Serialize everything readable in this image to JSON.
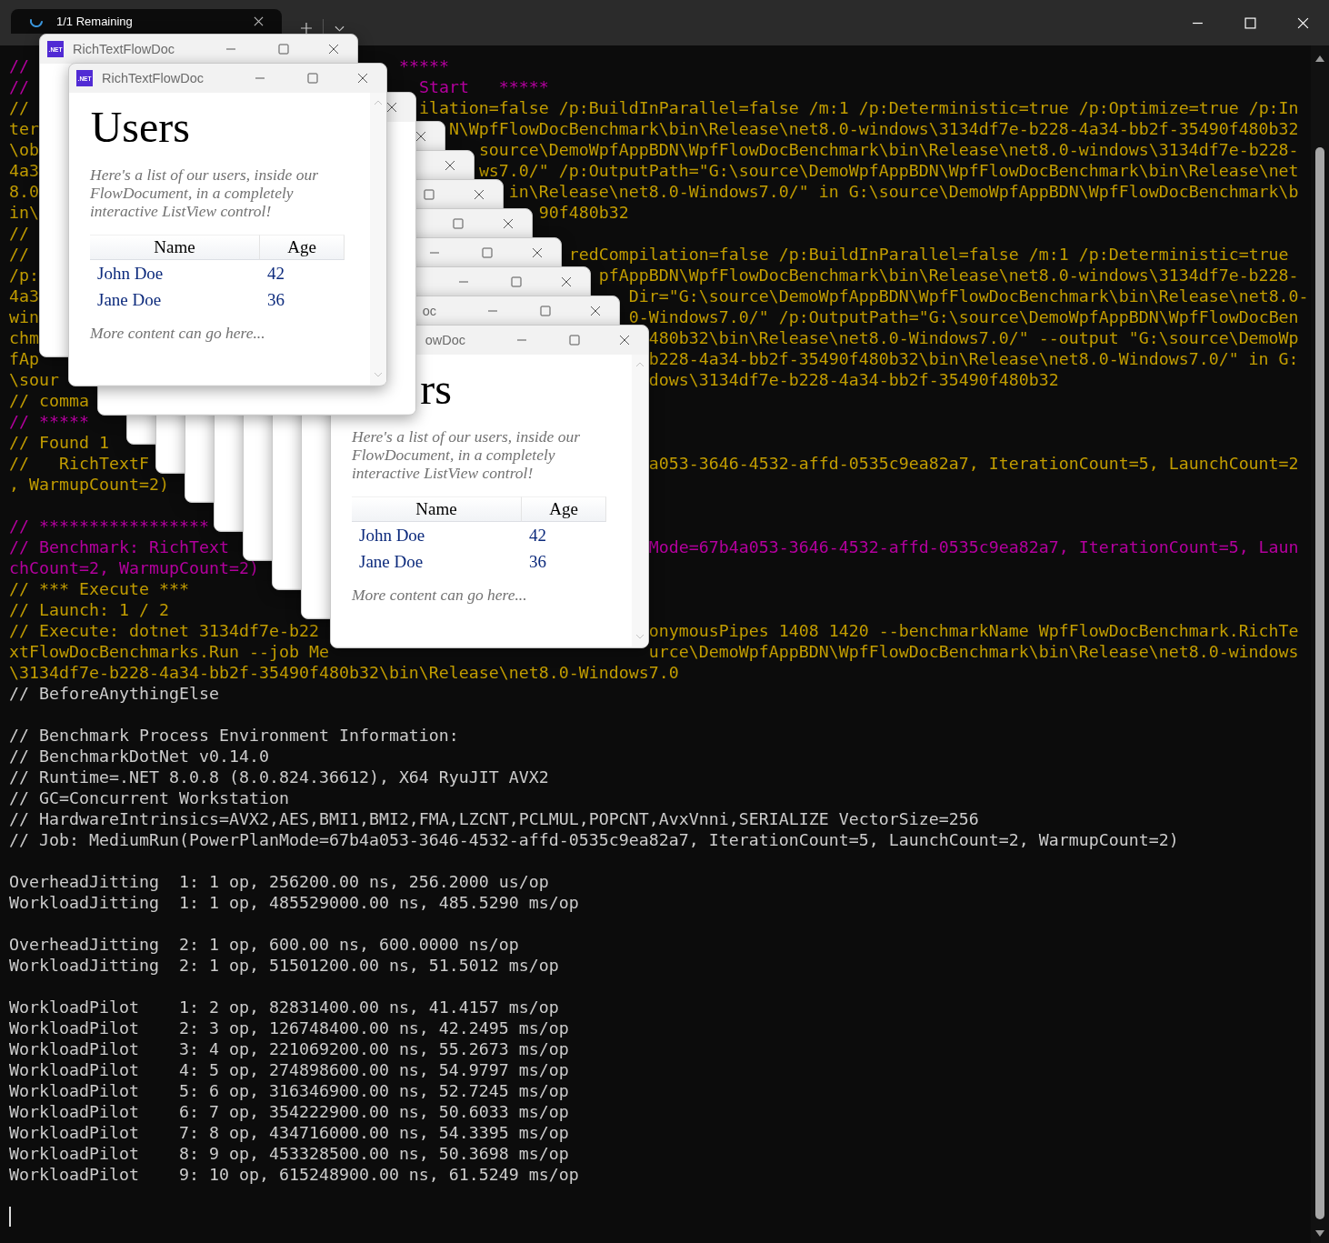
{
  "tab": {
    "title": "1/1 Remaining"
  },
  "terminal_lines": [
    {
      "kind": "text",
      "segments": [
        {
          "text": "//",
          "color": "#b4009e"
        },
        {
          "text": "                                     *****",
          "color": "#b4009e"
        }
      ]
    },
    {
      "kind": "text",
      "segments": [
        {
          "text": "//",
          "color": "#b4009e"
        },
        {
          "text": "                                       Start   *****",
          "color": "#b4009e"
        }
      ]
    },
    {
      "kind": "text",
      "segments": [
        {
          "text": "//",
          "color": "#c19c00"
        },
        {
          "text": "                                       ilation=false /p:BuildInParallel=false /m:1 /p:Deterministic=true /p:Optimize=true /p:In",
          "color": "#c19c00"
        }
      ]
    },
    {
      "kind": "text",
      "segments": [
        {
          "text": "ter",
          "color": "#c19c00"
        },
        {
          "text": "                                         N\\WpfFlowDocBenchmark\\bin\\Release\\net8.0-windows\\3134df7e-b228-4a34-bb2f-35490f480b32",
          "color": "#c19c00"
        }
      ]
    },
    {
      "kind": "text",
      "segments": [
        {
          "text": "\\ob",
          "color": "#c19c00"
        },
        {
          "text": "                                            source\\DemoWpfAppBDN\\WpfFlowDocBenchmark\\bin\\Release\\net8.0-windows\\3134df7e-b228-",
          "color": "#c19c00"
        }
      ]
    },
    {
      "kind": "text",
      "segments": [
        {
          "text": "4a3",
          "color": "#c19c00"
        },
        {
          "text": "                                            ws7.0/\" /p:OutputPath=\"G:\\source\\DemoWpfAppBDN\\WpfFlowDocBenchmark\\bin\\Release\\net",
          "color": "#c19c00"
        }
      ]
    },
    {
      "kind": "text",
      "segments": [
        {
          "text": "8.0",
          "color": "#c19c00"
        },
        {
          "text": "                                               in\\Release\\net8.0-Windows7.0/\" in G:\\source\\DemoWpfAppBDN\\WpfFlowDocBenchmark\\b",
          "color": "#c19c00"
        }
      ]
    },
    {
      "kind": "text",
      "segments": [
        {
          "text": "in\\",
          "color": "#c19c00"
        },
        {
          "text": "                                                  90f480b32",
          "color": "#c19c00"
        }
      ]
    },
    {
      "kind": "text",
      "segments": [
        {
          "text": "//",
          "color": "#c19c00"
        }
      ]
    },
    {
      "kind": "text",
      "segments": [
        {
          "text": "//",
          "color": "#c19c00"
        },
        {
          "text": "                                                      redCompilation=false /p:BuildInParallel=false /m:1 /p:Deterministic=true",
          "color": "#c19c00"
        }
      ]
    },
    {
      "kind": "text",
      "segments": [
        {
          "text": "/p:",
          "color": "#c19c00"
        },
        {
          "text": "                                                        pfAppBDN\\WpfFlowDocBenchmark\\bin\\Release\\net8.0-windows\\3134df7e-b228-",
          "color": "#c19c00"
        }
      ]
    },
    {
      "kind": "text",
      "segments": [
        {
          "text": "4a3",
          "color": "#c19c00"
        },
        {
          "text": "                                                           Dir=\"G:\\source\\DemoWpfAppBDN\\WpfFlowDocBenchmark\\bin\\Release\\net8.0-",
          "color": "#c19c00"
        }
      ]
    },
    {
      "kind": "text",
      "segments": [
        {
          "text": "win",
          "color": "#c19c00"
        },
        {
          "text": "                                                           0-Windows7.0/\" /p:OutputPath=\"G:\\source\\DemoWpfAppBDN\\WpfFlowDocBen",
          "color": "#c19c00"
        }
      ]
    },
    {
      "kind": "text",
      "segments": [
        {
          "text": "chm",
          "color": "#c19c00"
        },
        {
          "text": "                                                             480b32\\bin\\Release\\net8.0-Windows7.0/\" --output \"G:\\source\\DemoWp",
          "color": "#c19c00"
        }
      ]
    },
    {
      "kind": "text",
      "segments": [
        {
          "text": "fAp",
          "color": "#c19c00"
        },
        {
          "text": "                                                             b228-4a34-bb2f-35490f480b32\\bin\\Release\\net8.0-Windows7.0/\" in G:",
          "color": "#c19c00"
        }
      ]
    },
    {
      "kind": "text",
      "segments": [
        {
          "text": "\\sour",
          "color": "#c19c00"
        },
        {
          "text": "                                                           dows\\3134df7e-b228-4a34-bb2f-35490f480b32",
          "color": "#c19c00"
        }
      ]
    },
    {
      "kind": "text",
      "segments": [
        {
          "text": "// comma",
          "color": "#c19c00"
        }
      ]
    },
    {
      "kind": "text",
      "segments": [
        {
          "text": "// *****",
          "color": "#b4009e"
        }
      ]
    },
    {
      "kind": "text",
      "segments": [
        {
          "text": "// Found 1",
          "color": "#c19c00"
        }
      ]
    },
    {
      "kind": "text",
      "segments": [
        {
          "text": "//   RichTextF",
          "color": "#c19c00"
        },
        {
          "text": "                                                  a053-3646-4532-affd-0535c9ea82a7, IterationCount=5, LaunchCount=2",
          "color": "#c19c00"
        }
      ]
    },
    {
      "kind": "text",
      "segments": [
        {
          "text": ", WarmupCount=2)",
          "color": "#c19c00"
        }
      ]
    },
    {
      "kind": "blank"
    },
    {
      "kind": "text",
      "segments": [
        {
          "text": "// *****************",
          "color": "#b4009e"
        }
      ]
    },
    {
      "kind": "text",
      "segments": [
        {
          "text": "// Benchmark: RichText",
          "color": "#b4009e"
        },
        {
          "text": "                                          Mode=67b4a053-3646-4532-affd-0535c9ea82a7, IterationCount=5, Laun",
          "color": "#b4009e"
        }
      ]
    },
    {
      "kind": "text",
      "segments": [
        {
          "text": "chCount=2, WarmupCount=2)",
          "color": "#b4009e"
        }
      ]
    },
    {
      "kind": "text",
      "segments": [
        {
          "text": "// *** Execute ***",
          "color": "#c19c00"
        }
      ]
    },
    {
      "kind": "text",
      "segments": [
        {
          "text": "// Launch: 1 / 2",
          "color": "#c19c00"
        }
      ]
    },
    {
      "kind": "text",
      "segments": [
        {
          "text": "// Execute: dotnet 3134df7e-b22",
          "color": "#c19c00"
        },
        {
          "text": "                                 onymousPipes 1408 1420 --benchmarkName WpfFlowDocBenchmark.RichTe",
          "color": "#c19c00"
        }
      ]
    },
    {
      "kind": "text",
      "segments": [
        {
          "text": "xtFlowDocBenchmarks.Run --job Me",
          "color": "#c19c00"
        },
        {
          "text": "                                urce\\DemoWpfAppBDN\\WpfFlowDocBenchmark\\bin\\Release\\net8.0-windows",
          "color": "#c19c00"
        }
      ]
    },
    {
      "kind": "text",
      "segments": [
        {
          "text": "\\3134df7e-b228-4a34-bb2f-35490f480b32\\bin\\Release\\net8.0-Windows7.0",
          "color": "#c19c00"
        }
      ]
    },
    {
      "kind": "text",
      "segments": [
        {
          "text": "// BeforeAnythingElse",
          "color": "#cccccc"
        }
      ]
    },
    {
      "kind": "blank"
    },
    {
      "kind": "text",
      "segments": [
        {
          "text": "// Benchmark Process Environment Information:",
          "color": "#cccccc"
        }
      ]
    },
    {
      "kind": "text",
      "segments": [
        {
          "text": "// BenchmarkDotNet v0.14.0",
          "color": "#cccccc"
        }
      ]
    },
    {
      "kind": "text",
      "segments": [
        {
          "text": "// Runtime=.NET 8.0.8 (8.0.824.36612), X64 RyuJIT AVX2",
          "color": "#cccccc"
        }
      ]
    },
    {
      "kind": "text",
      "segments": [
        {
          "text": "// GC=Concurrent Workstation",
          "color": "#cccccc"
        }
      ]
    },
    {
      "kind": "text",
      "segments": [
        {
          "text": "// HardwareIntrinsics=AVX2,AES,BMI1,BMI2,FMA,LZCNT,PCLMUL,POPCNT,AvxVnni,SERIALIZE VectorSize=256",
          "color": "#cccccc"
        }
      ]
    },
    {
      "kind": "text",
      "segments": [
        {
          "text": "// Job: MediumRun(PowerPlanMode=67b4a053-3646-4532-affd-0535c9ea82a7, IterationCount=5, LaunchCount=2, WarmupCount=2)",
          "color": "#cccccc"
        }
      ]
    },
    {
      "kind": "blank"
    },
    {
      "kind": "text",
      "segments": [
        {
          "text": "OverheadJitting  1: 1 op, 256200.00 ns, 256.2000 us/op",
          "color": "#cccccc"
        }
      ]
    },
    {
      "kind": "text",
      "segments": [
        {
          "text": "WorkloadJitting  1: 1 op, 485529000.00 ns, 485.5290 ms/op",
          "color": "#cccccc"
        }
      ]
    },
    {
      "kind": "blank"
    },
    {
      "kind": "text",
      "segments": [
        {
          "text": "OverheadJitting  2: 1 op, 600.00 ns, 600.0000 ns/op",
          "color": "#cccccc"
        }
      ]
    },
    {
      "kind": "text",
      "segments": [
        {
          "text": "WorkloadJitting  2: 1 op, 51501200.00 ns, 51.5012 ms/op",
          "color": "#cccccc"
        }
      ]
    },
    {
      "kind": "blank"
    },
    {
      "kind": "text",
      "segments": [
        {
          "text": "WorkloadPilot    1: 2 op, 82831400.00 ns, 41.4157 ms/op",
          "color": "#cccccc"
        }
      ]
    },
    {
      "kind": "text",
      "segments": [
        {
          "text": "WorkloadPilot    2: 3 op, 126748400.00 ns, 42.2495 ms/op",
          "color": "#cccccc"
        }
      ]
    },
    {
      "kind": "text",
      "segments": [
        {
          "text": "WorkloadPilot    3: 4 op, 221069200.00 ns, 55.2673 ms/op",
          "color": "#cccccc"
        }
      ]
    },
    {
      "kind": "text",
      "segments": [
        {
          "text": "WorkloadPilot    4: 5 op, 274898600.00 ns, 54.9797 ms/op",
          "color": "#cccccc"
        }
      ]
    },
    {
      "kind": "text",
      "segments": [
        {
          "text": "WorkloadPilot    5: 6 op, 316346900.00 ns, 52.7245 ms/op",
          "color": "#cccccc"
        }
      ]
    },
    {
      "kind": "text",
      "segments": [
        {
          "text": "WorkloadPilot    6: 7 op, 354222900.00 ns, 50.6033 ms/op",
          "color": "#cccccc"
        }
      ]
    },
    {
      "kind": "text",
      "segments": [
        {
          "text": "WorkloadPilot    7: 8 op, 434716000.00 ns, 54.3395 ms/op",
          "color": "#cccccc"
        }
      ]
    },
    {
      "kind": "text",
      "segments": [
        {
          "text": "WorkloadPilot    8: 9 op, 453328500.00 ns, 50.3698 ms/op",
          "color": "#cccccc"
        }
      ]
    },
    {
      "kind": "text",
      "segments": [
        {
          "text": "WorkloadPilot    9: 10 op, 615248900.00 ns, 61.5249 ms/op",
          "color": "#cccccc"
        }
      ]
    },
    {
      "kind": "blank"
    },
    {
      "kind": "cursor"
    }
  ],
  "app_windows": [
    {
      "kind": "flow_document",
      "icon_label": ".NET",
      "title": "RichTextFlowDoc"
    },
    {
      "kind": "flow_document",
      "icon_label": ".NET",
      "title": "RichTextFlowDoc",
      "heading": "Users",
      "intro": "Here's a list of our users, inside our FlowDocument, in a completely interactive ListView control!",
      "columns": [
        "Name",
        "Age"
      ],
      "rows": [
        [
          "John Doe",
          "42"
        ],
        [
          "Jane Doe",
          "36"
        ]
      ],
      "footer": "More content can go here..."
    },
    {
      "kind": "flow_document"
    },
    {
      "kind": "flow_document"
    },
    {
      "kind": "flow_document"
    },
    {
      "kind": "flow_document"
    },
    {
      "kind": "flow_document"
    },
    {
      "kind": "flow_document"
    },
    {
      "kind": "flow_document"
    },
    {
      "kind": "flow_document",
      "title": "oc"
    },
    {
      "kind": "flow_document",
      "title": "owDoc",
      "heading": "rs",
      "intro": "Here's a list of our users, inside our FlowDocument, in a completely interactive ListView control!",
      "columns": [
        "Name",
        "Age"
      ],
      "rows": [
        [
          "John Doe",
          "42"
        ],
        [
          "Jane Doe",
          "36"
        ]
      ],
      "footer": "More content can go here..."
    }
  ]
}
